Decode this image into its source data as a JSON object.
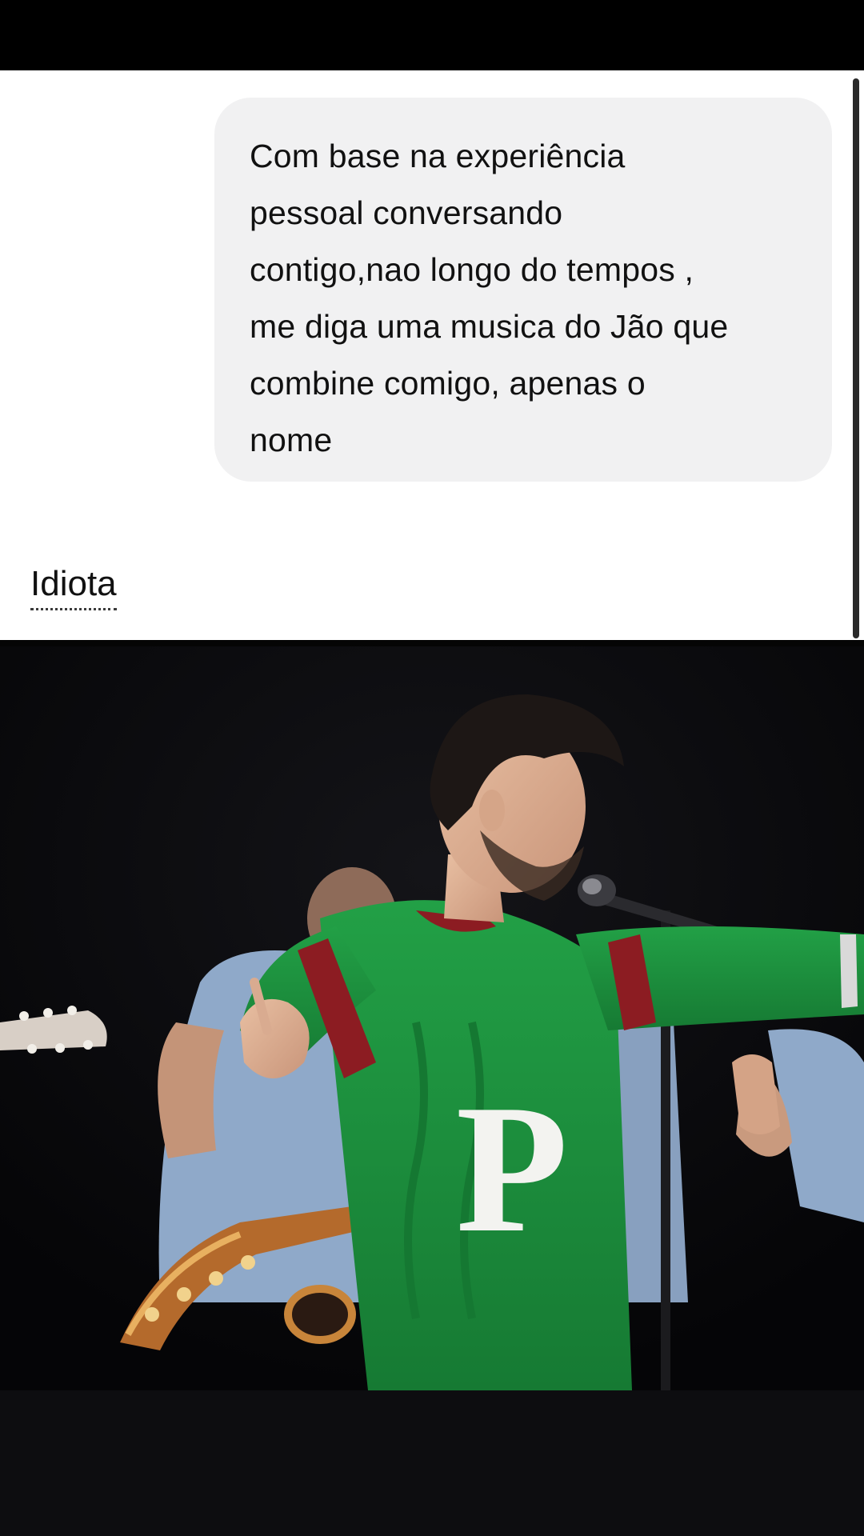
{
  "conversation": {
    "user_message": "Com base na experiência\npessoal conversando\ncontigo,nao longo do tempos ,\nme diga uma musica do Jão que\ncombine comigo, apenas o\nnome",
    "reply_text": "Idiota"
  },
  "media": {
    "sweater_letter": "P"
  },
  "colors": {
    "bubble": "#f1f1f2",
    "text": "#111111",
    "sweater": "#1f8a3a",
    "stripe": "#8c1c22"
  }
}
